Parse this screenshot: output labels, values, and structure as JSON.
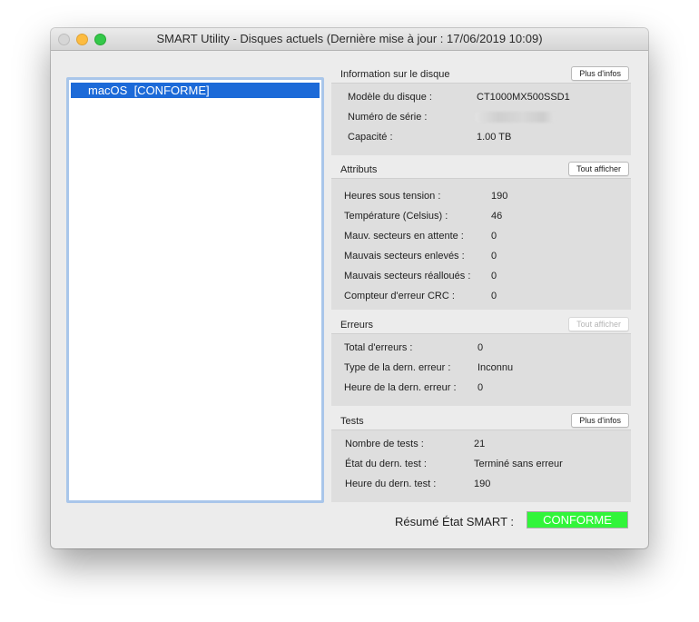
{
  "window": {
    "title": "SMART Utility - Disques actuels (Dernière mise à jour : 17/06/2019 10:09)"
  },
  "disks": [
    {
      "label": "macOS  [CONFORME]"
    }
  ],
  "disk_info": {
    "heading": "Information sur le disque",
    "button": "Plus d'infos",
    "rows": [
      {
        "label": "Modèle du disque :",
        "value": "CT1000MX500SSD1"
      },
      {
        "label": "Numéro de série :",
        "value": ""
      },
      {
        "label": "Capacité :",
        "value": "1.00 TB"
      }
    ]
  },
  "attributes": {
    "heading": "Attributs",
    "button": "Tout afficher",
    "rows": [
      {
        "label": "Heures sous tension :",
        "value": "190"
      },
      {
        "label": "Température (Celsius) :",
        "value": "46"
      },
      {
        "label": "Mauv. secteurs en attente :",
        "value": "0"
      },
      {
        "label": "Mauvais secteurs enlevés :",
        "value": "0"
      },
      {
        "label": "Mauvais secteurs réalloués :",
        "value": "0"
      },
      {
        "label": "Compteur d'erreur CRC :",
        "value": "0"
      }
    ]
  },
  "errors": {
    "heading": "Erreurs",
    "button": "Tout afficher",
    "rows": [
      {
        "label": "Total d'erreurs :",
        "value": "0"
      },
      {
        "label": "Type de la dern. erreur :",
        "value": "Inconnu"
      },
      {
        "label": "Heure de la dern. erreur :",
        "value": "0"
      }
    ]
  },
  "tests": {
    "heading": "Tests",
    "button": "Plus d'infos",
    "rows": [
      {
        "label": "Nombre de tests :",
        "value": "21"
      },
      {
        "label": "État du dern. test :",
        "value": "Terminé sans erreur"
      },
      {
        "label": "Heure du dern. test :",
        "value": "190"
      }
    ]
  },
  "summary": {
    "label": "Résumé État SMART :",
    "status": "CONFORME",
    "status_color": "#31f53a"
  }
}
